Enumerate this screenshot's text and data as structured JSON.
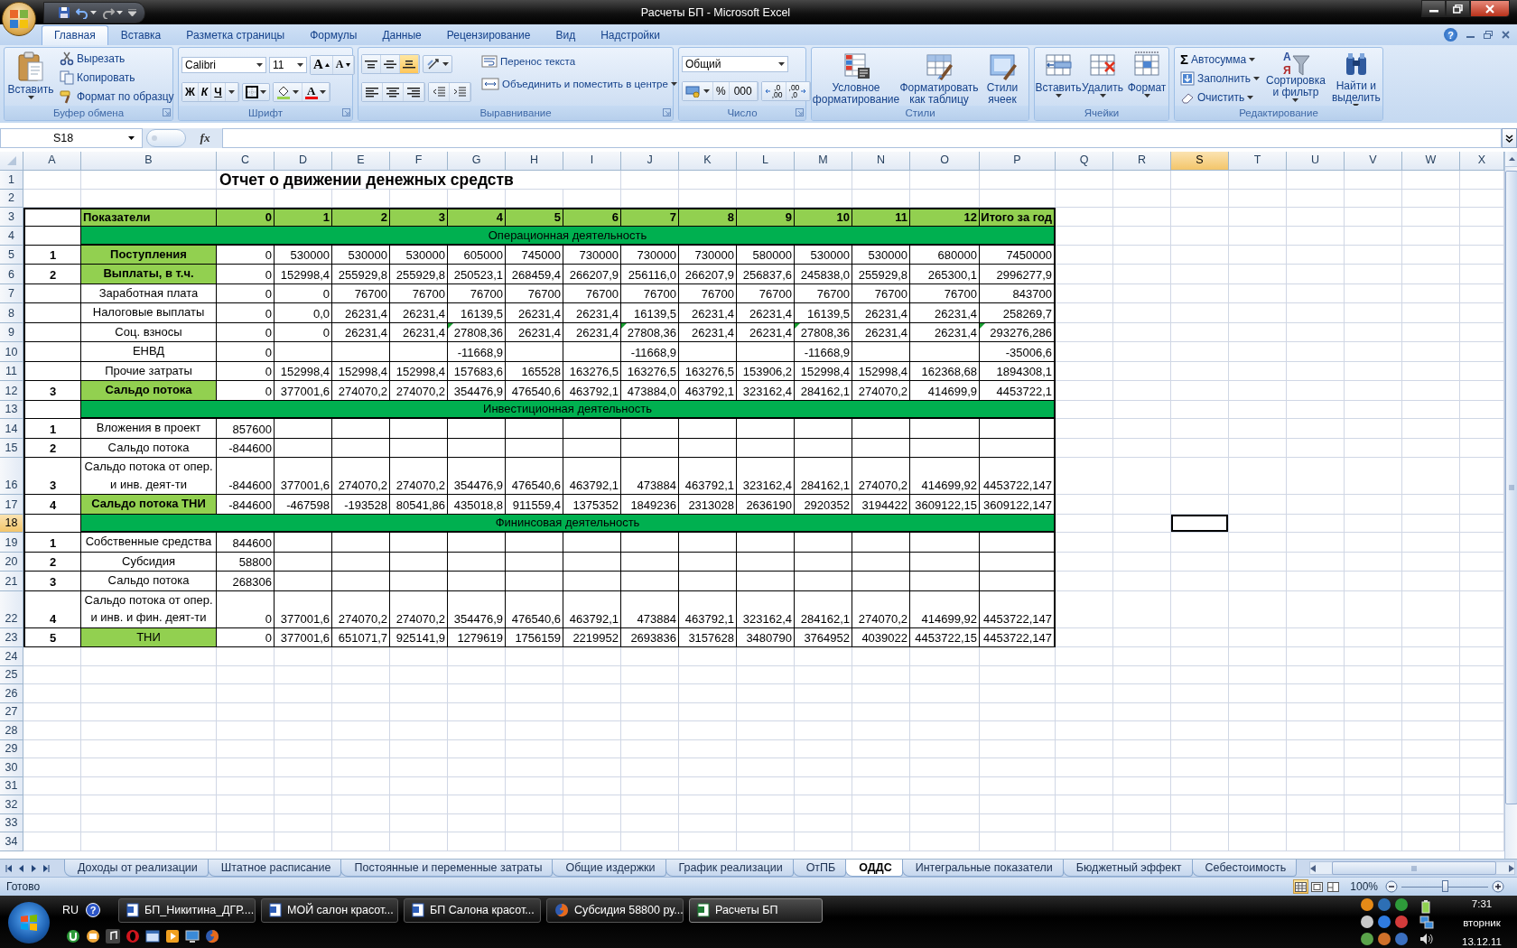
{
  "window": {
    "title": "Расчеты БП - Microsoft Excel"
  },
  "ribbon": {
    "tabs": [
      {
        "label": "Главная",
        "selected": true
      },
      {
        "label": "Вставка",
        "selected": false
      },
      {
        "label": "Разметка страницы",
        "selected": false
      },
      {
        "label": "Формулы",
        "selected": false
      },
      {
        "label": "Данные",
        "selected": false
      },
      {
        "label": "Рецензирование",
        "selected": false
      },
      {
        "label": "Вид",
        "selected": false
      },
      {
        "label": "Надстройки",
        "selected": false
      }
    ],
    "help": "?",
    "clipboard": {
      "label": "Буфер обмена",
      "paste": "Вставить",
      "cut": "Вырезать",
      "copy": "Копировать",
      "format_painter": "Формат по образцу"
    },
    "font": {
      "label": "Шрифт",
      "font_name": "Calibri",
      "font_size": "11",
      "grow": "A",
      "shrink": "A",
      "bold": "Ж",
      "italic": "К",
      "underline": "Ч",
      "font_color": "A"
    },
    "alignment": {
      "label": "Выравнивание",
      "vertical": [
        {
          "kind": "top",
          "selected": false
        },
        {
          "kind": "middle",
          "selected": false
        },
        {
          "kind": "bottom",
          "selected": true
        }
      ],
      "wrap": "Перенос текста",
      "merge": "Объединить и поместить в центре"
    },
    "number": {
      "label": "Число",
      "format": "Общий",
      "percent": "%",
      "thousands": "000",
      "increase_decimal": [
        ",0",
        ",00"
      ],
      "decrease_decimal": [
        ",00",
        ",0"
      ]
    },
    "styles": {
      "label": "Стили",
      "buttons": [
        {
          "kind": "conditional",
          "label": "Условное форматирование"
        },
        {
          "kind": "table",
          "label": "Форматировать как таблицу"
        },
        {
          "kind": "cell-styles",
          "label": "Стили ячеек"
        }
      ]
    },
    "cells": {
      "label": "Ячейки",
      "buttons": [
        {
          "kind": "insert",
          "label": "Вставить"
        },
        {
          "kind": "delete",
          "label": "Удалить"
        },
        {
          "kind": "format",
          "label": "Формат"
        }
      ]
    },
    "editing": {
      "label": "Редактирование",
      "autosum_symbol": "Σ",
      "autosum": "Автосумма",
      "fill": "Заполнить",
      "clear": "Очистить",
      "sort_letters": [
        "А",
        "Я"
      ],
      "sort": "Сортировка и фильтр",
      "find": "Найти и выделить"
    }
  },
  "formula_bar": {
    "name_box": "S18",
    "fx": "fx"
  },
  "sheet": {
    "columns": [
      {
        "label": "A",
        "selected": false
      },
      {
        "label": "B",
        "selected": false
      },
      {
        "label": "C",
        "selected": false
      },
      {
        "label": "D",
        "selected": false
      },
      {
        "label": "E",
        "selected": false
      },
      {
        "label": "F",
        "selected": false
      },
      {
        "label": "G",
        "selected": false
      },
      {
        "label": "H",
        "selected": false
      },
      {
        "label": "I",
        "selected": false
      },
      {
        "label": "J",
        "selected": false
      },
      {
        "label": "K",
        "selected": false
      },
      {
        "label": "L",
        "selected": false
      },
      {
        "label": "M",
        "selected": false
      },
      {
        "label": "N",
        "selected": false
      },
      {
        "label": "O",
        "selected": false
      },
      {
        "label": "P",
        "selected": false
      },
      {
        "label": "Q",
        "selected": false
      },
      {
        "label": "R",
        "selected": false
      },
      {
        "label": "S",
        "selected": true
      },
      {
        "label": "T",
        "selected": false
      },
      {
        "label": "U",
        "selected": false
      },
      {
        "label": "V",
        "selected": false
      },
      {
        "label": "W",
        "selected": false
      },
      {
        "label": "X",
        "selected": false
      }
    ],
    "rows": [
      {
        "num": "1",
        "kind": "title",
        "selected": false,
        "title": "Отчет о движении денежных средств"
      },
      {
        "num": "2",
        "kind": "blank",
        "selected": false
      },
      {
        "num": "3",
        "kind": "header",
        "selected": false,
        "label": "Показатели",
        "values": [
          "0",
          "1",
          "2",
          "3",
          "4",
          "5",
          "6",
          "7",
          "8",
          "9",
          "10",
          "11",
          "12",
          "Итого за год"
        ]
      },
      {
        "num": "4",
        "kind": "section",
        "selected": false,
        "label": "Операционная деятельность"
      },
      {
        "num": "5",
        "kind": "data",
        "selected": false,
        "index": "1",
        "label": "Поступления",
        "highlight": true,
        "bold": true,
        "values": [
          "0",
          "530000",
          "530000",
          "530000",
          "605000",
          "745000",
          "730000",
          "730000",
          "730000",
          "580000",
          "530000",
          "530000",
          "680000",
          "7450000"
        ]
      },
      {
        "num": "6",
        "kind": "data",
        "selected": false,
        "index": "2",
        "label": "Выплаты, в т.ч.",
        "highlight": true,
        "bold": true,
        "values": [
          "0",
          "152998,4",
          "255929,8",
          "255929,8",
          "250523,1",
          "268459,4",
          "266207,9",
          "256116,0",
          "266207,9",
          "256837,6",
          "245838,0",
          "255929,8",
          "265300,1",
          "2996277,9"
        ]
      },
      {
        "num": "7",
        "kind": "data",
        "selected": false,
        "label": "Заработная плата",
        "highlight": false,
        "bold": false,
        "values": [
          "0",
          "0",
          "76700",
          "76700",
          "76700",
          "76700",
          "76700",
          "76700",
          "76700",
          "76700",
          "76700",
          "76700",
          "76700",
          "843700"
        ]
      },
      {
        "num": "8",
        "kind": "data",
        "selected": false,
        "label": "Налоговые выплаты",
        "highlight": false,
        "bold": false,
        "values": [
          "0",
          "0,0",
          "26231,4",
          "26231,4",
          "16139,5",
          "26231,4",
          "26231,4",
          "16139,5",
          "26231,4",
          "26231,4",
          "16139,5",
          "26231,4",
          "26231,4",
          "258269,7"
        ]
      },
      {
        "num": "9",
        "kind": "data",
        "selected": false,
        "label": "Соц. взносы",
        "highlight": false,
        "bold": false,
        "values": [
          "0",
          "0",
          "26231,4",
          "26231,4",
          {
            "text": "27808,36",
            "warning": true
          },
          "26231,4",
          "26231,4",
          {
            "text": "27808,36",
            "warning": true
          },
          "26231,4",
          "26231,4",
          {
            "text": "27808,36",
            "warning": true
          },
          "26231,4",
          "26231,4",
          {
            "text": "293276,286",
            "warning": true
          }
        ]
      },
      {
        "num": "10",
        "kind": "data",
        "selected": false,
        "label": "ЕНВД",
        "highlight": false,
        "bold": false,
        "values": [
          "0",
          {
            "kind": "blank"
          },
          {
            "kind": "blank"
          },
          {
            "kind": "blank"
          },
          "-11668,9",
          {
            "kind": "blank"
          },
          {
            "kind": "blank"
          },
          "-11668,9",
          {
            "kind": "blank"
          },
          {
            "kind": "blank"
          },
          "-11668,9",
          {
            "kind": "blank"
          },
          {
            "kind": "blank"
          },
          "-35006,6"
        ]
      },
      {
        "num": "11",
        "kind": "data",
        "selected": false,
        "label": "Прочие затраты",
        "highlight": false,
        "bold": false,
        "values": [
          "0",
          "152998,4",
          "152998,4",
          "152998,4",
          "157683,6",
          "165528",
          "163276,5",
          "163276,5",
          "163276,5",
          "153906,2",
          "152998,4",
          "152998,4",
          "162368,68",
          "1894308,1"
        ]
      },
      {
        "num": "12",
        "kind": "data",
        "selected": false,
        "index": "3",
        "label": "Сальдо потока",
        "highlight": true,
        "bold": true,
        "values": [
          "0",
          "377001,6",
          "274070,2",
          "274070,2",
          "354476,9",
          "476540,6",
          "463792,1",
          "473884,0",
          "463792,1",
          "323162,4",
          "284162,1",
          "274070,2",
          "414699,9",
          "4453722,1"
        ]
      },
      {
        "num": "13",
        "kind": "section",
        "selected": false,
        "label": "Инвестиционная деятельность"
      },
      {
        "num": "14",
        "kind": "data",
        "selected": false,
        "index": "1",
        "label": "Вложения в проект",
        "highlight": false,
        "bold": false,
        "values": [
          "857600"
        ]
      },
      {
        "num": "15",
        "kind": "data",
        "selected": false,
        "index": "2",
        "label": "Сальдо потока",
        "highlight": false,
        "bold": false,
        "values": [
          "-844600"
        ]
      },
      {
        "num": "16",
        "kind": "data",
        "selected": false,
        "index": "3",
        "label": "Сальдо потока от опер. и инв. деят-ти",
        "highlight": false,
        "bold": false,
        "values": [
          "-844600",
          "377001,6",
          "274070,2",
          "274070,2",
          "354476,9",
          "476540,6",
          "463792,1",
          "473884",
          "463792,1",
          "323162,4",
          "284162,1",
          "274070,2",
          "414699,92",
          "4453722,147"
        ]
      },
      {
        "num": "17",
        "kind": "data",
        "selected": false,
        "index": "4",
        "label": "Сальдо потока ТНИ",
        "highlight": true,
        "bold": true,
        "values": [
          "-844600",
          "-467598",
          "-193528",
          "80541,86",
          "435018,8",
          "911559,4",
          "1375352",
          "1849236",
          "2313028",
          "2636190",
          "2920352",
          "3194422",
          "3609122,15",
          "3609122,147"
        ]
      },
      {
        "num": "18",
        "kind": "section",
        "selected": true,
        "label": "Фининсовая деятельность"
      },
      {
        "num": "19",
        "kind": "data",
        "selected": false,
        "index": "1",
        "label": "Собственные средства",
        "highlight": false,
        "bold": false,
        "values": [
          "844600"
        ]
      },
      {
        "num": "20",
        "kind": "data",
        "selected": false,
        "index": "2",
        "label": "Субсидия",
        "highlight": false,
        "bold": false,
        "values": [
          "58800"
        ]
      },
      {
        "num": "21",
        "kind": "data",
        "selected": false,
        "index": "3",
        "label": "Сальдо потока",
        "highlight": false,
        "bold": false,
        "values": [
          "268306"
        ]
      },
      {
        "num": "22",
        "kind": "data",
        "selected": false,
        "index": "4",
        "label": "Сальдо потока от опер. и инв. и фин. деят-ти",
        "highlight": false,
        "bold": false,
        "values": [
          "0",
          "377001,6",
          "274070,2",
          "274070,2",
          "354476,9",
          "476540,6",
          "463792,1",
          "473884",
          "463792,1",
          "323162,4",
          "284162,1",
          "274070,2",
          "414699,92",
          "4453722,147"
        ]
      },
      {
        "num": "23",
        "kind": "data",
        "selected": false,
        "index": "5",
        "label": "ТНИ",
        "highlight": true,
        "bold": false,
        "values": [
          "0",
          "377001,6",
          "651071,7",
          "925141,9",
          "1279619",
          "1756159",
          "2219952",
          "2693836",
          "3157628",
          "3480790",
          "3764952",
          "4039022",
          "4453722,15",
          "4453722,147"
        ]
      },
      {
        "num": "24",
        "kind": "blank",
        "selected": false
      },
      {
        "num": "25",
        "kind": "blank",
        "selected": false
      },
      {
        "num": "26",
        "kind": "blank",
        "selected": false
      },
      {
        "num": "27",
        "kind": "blank",
        "selected": false
      },
      {
        "num": "28",
        "kind": "blank",
        "selected": false
      },
      {
        "num": "29",
        "kind": "blank",
        "selected": false
      },
      {
        "num": "30",
        "kind": "blank",
        "selected": false
      },
      {
        "num": "31",
        "kind": "blank",
        "selected": false
      },
      {
        "num": "32",
        "kind": "blank",
        "selected": false
      },
      {
        "num": "33",
        "kind": "blank",
        "selected": false
      },
      {
        "num": "34",
        "kind": "blank",
        "selected": false
      }
    ]
  },
  "sheet_tabs": [
    {
      "label": "Доходы от реализации",
      "selected": false
    },
    {
      "label": "Штатное расписание",
      "selected": false
    },
    {
      "label": "Постоянные и переменные затраты",
      "selected": false
    },
    {
      "label": "Общие издержки",
      "selected": false
    },
    {
      "label": "График реализации",
      "selected": false
    },
    {
      "label": "ОтПБ",
      "selected": false
    },
    {
      "label": "ОДДС",
      "selected": true
    },
    {
      "label": "Интегральные показатели",
      "selected": false
    },
    {
      "label": "Бюджетный эффект",
      "selected": false
    },
    {
      "label": "Себестоимость",
      "selected": false
    }
  ],
  "status_bar": {
    "text": "Готово",
    "views": [
      {
        "kind": "normal",
        "selected": true
      },
      {
        "kind": "page-layout",
        "selected": false
      },
      {
        "kind": "page-break",
        "selected": false
      }
    ],
    "zoom": {
      "label": "100%",
      "level": 0.5
    }
  },
  "taskbar": {
    "language": "RU",
    "help": "?",
    "tasks": [
      {
        "kind": "word",
        "label": "БП_Никитина_ДГР....",
        "selected": false
      },
      {
        "kind": "word",
        "label": "МОЙ салон красот...",
        "selected": false
      },
      {
        "kind": "word",
        "label": "БП Салона красот...",
        "selected": false
      },
      {
        "kind": "firefox",
        "label": "Субсидия 58800 ру...",
        "selected": false
      },
      {
        "kind": "excel",
        "label": "Расчеты БП",
        "selected": true
      }
    ],
    "clock": {
      "time": "7:31",
      "day": "вторник",
      "date": "13.12.11"
    }
  }
}
